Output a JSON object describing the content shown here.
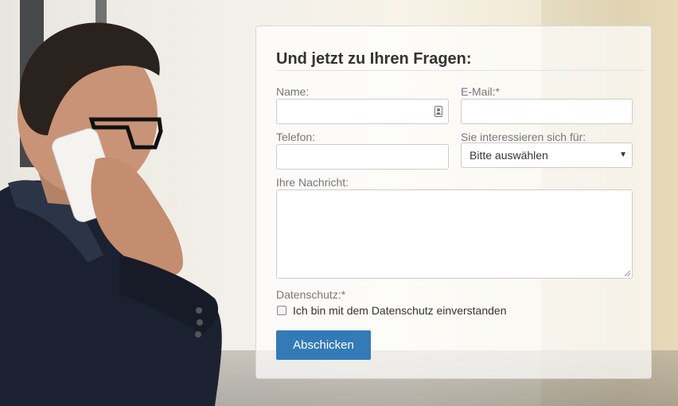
{
  "form": {
    "title": "Und jetzt zu Ihren Fragen:",
    "name": {
      "label": "Name:",
      "value": ""
    },
    "email": {
      "label": "E-Mail:*",
      "value": ""
    },
    "phone": {
      "label": "Telefon:",
      "value": ""
    },
    "interest": {
      "label": "Sie interessieren sich für:",
      "selected": "Bitte auswählen"
    },
    "message": {
      "label": "Ihre Nachricht:",
      "value": ""
    },
    "privacy": {
      "label": "Datenschutz:*",
      "checkbox_label": "Ich bin mit dem Datenschutz einverstanden",
      "checked": false
    },
    "submit_label": "Abschicken"
  },
  "colors": {
    "submit_button": "#337ab7",
    "label_text": "#777777",
    "title_text": "#333333"
  },
  "icons": {
    "name_field_icon": "contact-card-icon",
    "select_arrow": "caret-down-icon"
  }
}
